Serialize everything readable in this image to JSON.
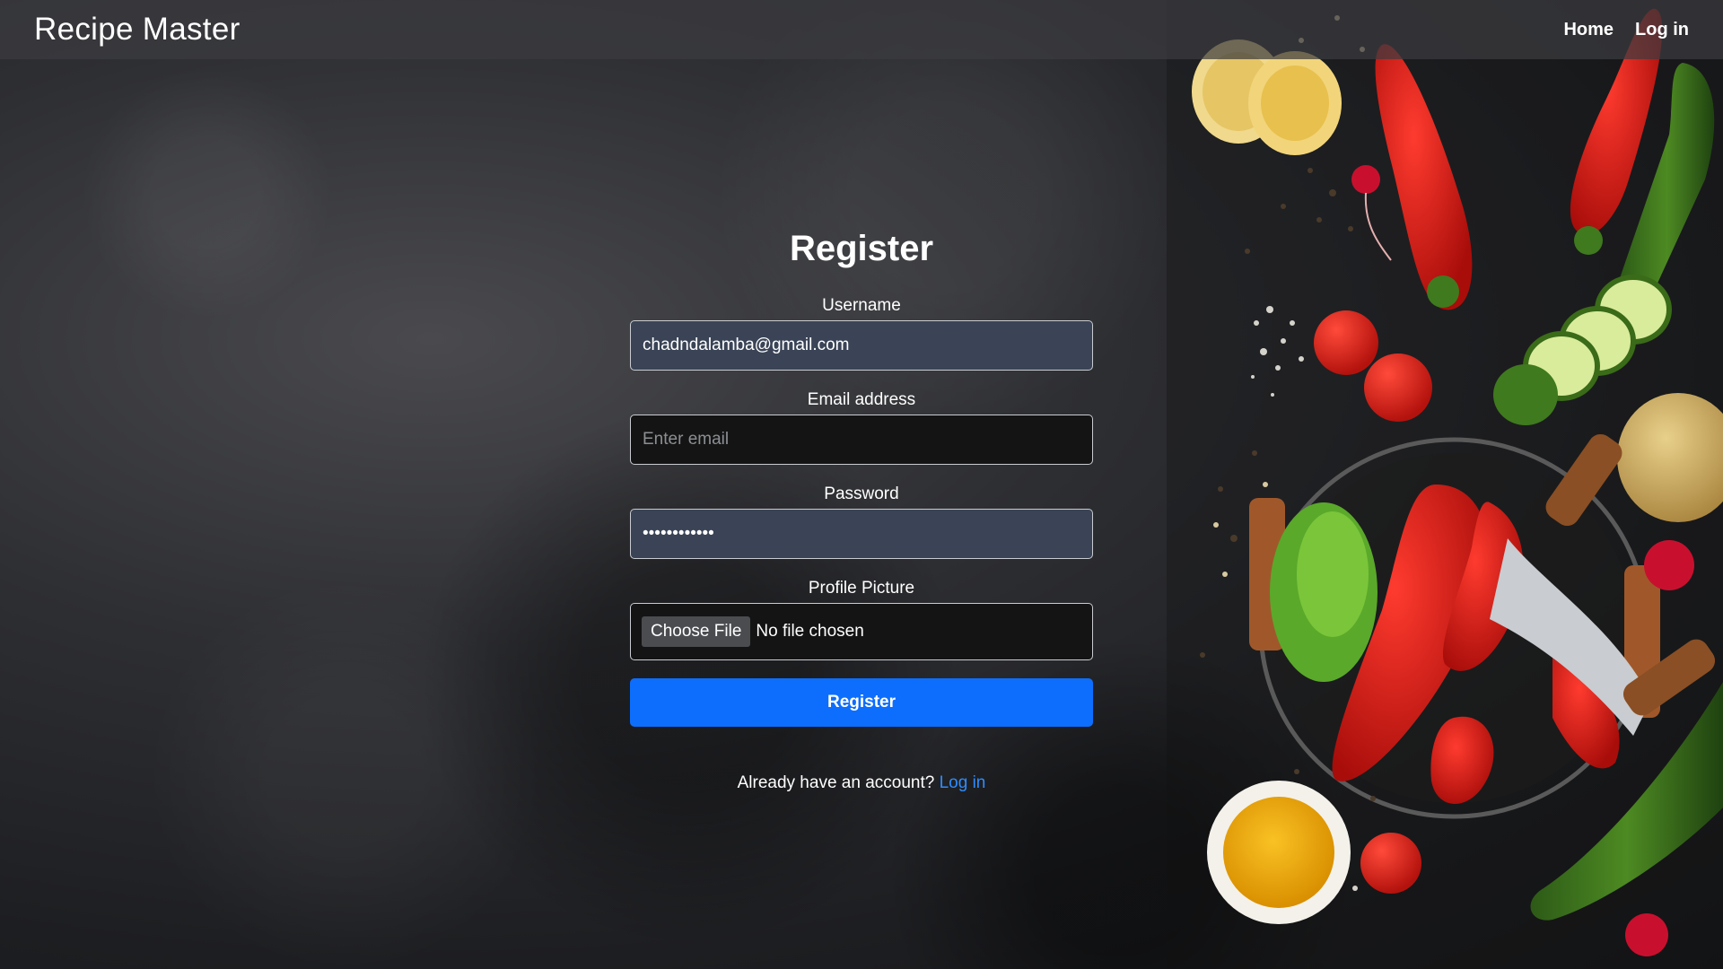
{
  "navbar": {
    "brand": "Recipe Master",
    "links": [
      "Home",
      "Log in"
    ]
  },
  "form": {
    "title": "Register",
    "username": {
      "label": "Username",
      "value": "chadndalamba@gmail.com"
    },
    "email": {
      "label": "Email address",
      "placeholder": "Enter email",
      "value": ""
    },
    "password": {
      "label": "Password",
      "value": "••••••••••••"
    },
    "profile_picture": {
      "label": "Profile Picture",
      "button": "Choose File",
      "status": "No file chosen"
    },
    "submit": "Register",
    "login_prompt": "Already have an account?",
    "login_link": "Log in"
  },
  "colors": {
    "primary_button": "#0d6efd",
    "link": "#2f8cff",
    "filled_input": "#3a4456",
    "empty_input": "#141414"
  },
  "decor": {
    "hero_image": "vegetables-flatlay"
  }
}
